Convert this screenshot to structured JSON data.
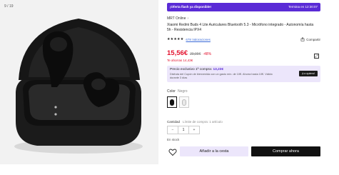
{
  "gallery": {
    "counter": "9 / 19",
    "image_alt": "Xiaomi Redmi Buds 4 Lite black earbuds in case"
  },
  "flash": {
    "label": "¡Oferta flash ya disponible!",
    "timer": "Termina en 12:30:07",
    "color": "#5a2bd6"
  },
  "seller": {
    "name": "MRT Online"
  },
  "product": {
    "title": "Xiaomi Redmi Buds 4 Lite Auriculares Bluetooth 5.3 - Micrófono integrado - Autonomía hasta 5h - Resistencia IPX4",
    "stars": "★★★★★",
    "reviews": "678 Valoraciones",
    "share": "Compartir",
    "share_icon": "share-icon"
  },
  "price": {
    "current": "15,56€",
    "old": "29,99€",
    "discount": "-48%",
    "saving": "Te ahorras 14,43€",
    "color": "#e3122e"
  },
  "promo": {
    "title_prefix": "Precio exclusivo 1ª compra:",
    "title_price": "13,23€",
    "description": "Disfruta del Cupón de bienvenida con un gasto mín. de 10€. Ahorra hasta 10€. Válido durante 3 días",
    "button": "¡Lo quiero!"
  },
  "color": {
    "label": "Color",
    "selected": "Negro",
    "options": [
      "Negro",
      "Blanco"
    ]
  },
  "quantity": {
    "label": "Cantidad",
    "limit": "Límite de compra: 1 artículo",
    "minus": "−",
    "value": "1",
    "plus": "+"
  },
  "stock": "En stock",
  "actions": {
    "add_to_cart": "Añadir a la cesta",
    "buy_now": "Comprar ahora"
  }
}
